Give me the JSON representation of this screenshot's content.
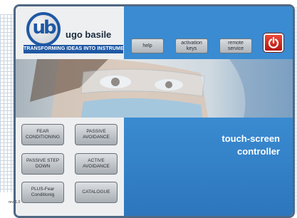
{
  "brand": {
    "name": "ugo basile",
    "tagline": "TRANSFORMING IDEAS INTO INSTRUMENTS",
    "logo_mark": "ub"
  },
  "header": {
    "help_label": "help",
    "activation_label": "activation keys",
    "remote_label": "remote service",
    "power_icon": "power-icon"
  },
  "menu": {
    "fear_conditioning": "FEAR CONDITIONING",
    "passive_avoidance": "PASSIVE AVOIDANCE",
    "passive_step_down": "PASSIVE STEP DOWN",
    "active_avoidance": "ACTIVE AVOIDANCE",
    "plus_fear": "PLUS-Fear Conditionig",
    "catalogue": "CATALOGUE"
  },
  "title": {
    "line1": "touch-screen",
    "line2": "controller"
  },
  "footer": {
    "revision": "rev. 1.0"
  },
  "colors": {
    "accent": "#3a8bd1",
    "brand_blue": "#1f58a4",
    "power_red": "#d12a1c"
  }
}
